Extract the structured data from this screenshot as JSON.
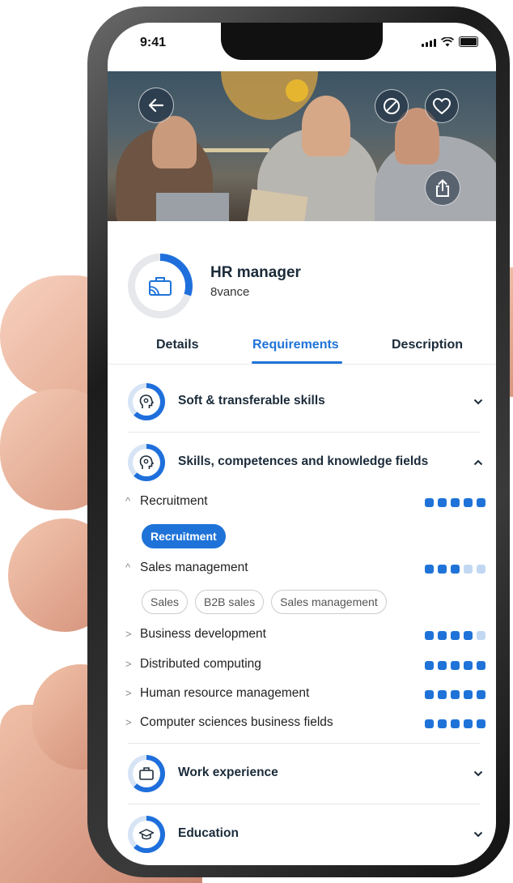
{
  "status": {
    "time": "9:41"
  },
  "job": {
    "title": "HR manager",
    "company": "8vance"
  },
  "tabs": [
    {
      "label": "Details"
    },
    {
      "label": "Requirements"
    },
    {
      "label": "Description"
    }
  ],
  "sections": {
    "soft": {
      "title": "Soft & transferable skills"
    },
    "skills": {
      "title": "Skills, competences and knowledge fields",
      "items": [
        {
          "label": "Recruitment",
          "level": 5,
          "chips": [
            "Recruitment"
          ]
        },
        {
          "label": "Sales management",
          "level": 3,
          "chips": [
            "Sales",
            "B2B sales",
            "Sales management"
          ]
        },
        {
          "label": "Business development",
          "level": 4
        },
        {
          "label": "Distributed computing",
          "level": 5
        },
        {
          "label": "Human resource management",
          "level": 5
        },
        {
          "label": "Computer sciences business fields",
          "level": 5
        }
      ]
    },
    "work": {
      "title": "Work experience"
    },
    "education": {
      "title": "Education"
    }
  },
  "colors": {
    "accent": "#1f73d8",
    "text": "#1b2b3a",
    "dot_off": "#c2d8f2"
  },
  "icons": [
    "back-arrow-icon",
    "block-icon",
    "heart-icon",
    "share-icon",
    "briefcase-icon",
    "head-gear-icon",
    "graduation-cap-icon",
    "chevron-down-icon",
    "chevron-up-icon"
  ]
}
